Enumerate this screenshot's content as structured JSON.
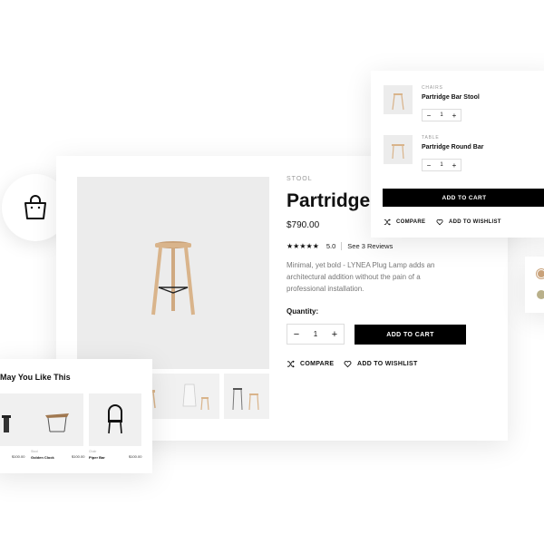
{
  "product": {
    "category": "STOOL",
    "title": "Partridge",
    "price": "$790.00",
    "rating_value": "5.0",
    "reviews_link": "See 3 Reviews",
    "description": "Minimal, yet bold - LYNEA Plug Lamp adds an architectural addition without the pain of a professional installation.",
    "quantity_label": "Quantity:",
    "quantity_value": "1",
    "add_to_cart": "ADD TO CART",
    "compare": "COMPARE",
    "wishlist": "ADD TO WISHLIST"
  },
  "cart": {
    "items": [
      {
        "category": "CHAIRS",
        "name": "Partridge Bar Stool",
        "qty": "1"
      },
      {
        "category": "TABLE",
        "name": "Partridge Round Bar",
        "qty": "1"
      }
    ],
    "add_to_cart": "ADD TO CART",
    "compare": "COMPARE",
    "wishlist": "ADD TO WISHLIST"
  },
  "recommendations": {
    "title": "May You Like This",
    "items": [
      {
        "category": "",
        "name": "",
        "price": "$100.00"
      },
      {
        "category": "Stool",
        "name": "Golden Clock",
        "price": "$100.00"
      },
      {
        "category": "Chair",
        "name": "Piper Bar",
        "price": "$100.00"
      }
    ]
  },
  "colors": {
    "accent": "#000000",
    "image_bg": "#ececec",
    "wood": "#d9b48b",
    "swatch_1": "#c9a27a",
    "swatch_2": "#b9b08a"
  },
  "icons": {
    "bag": "shopping-bag-icon",
    "compare": "shuffle-icon",
    "wishlist": "heart-icon",
    "star": "star-icon"
  }
}
